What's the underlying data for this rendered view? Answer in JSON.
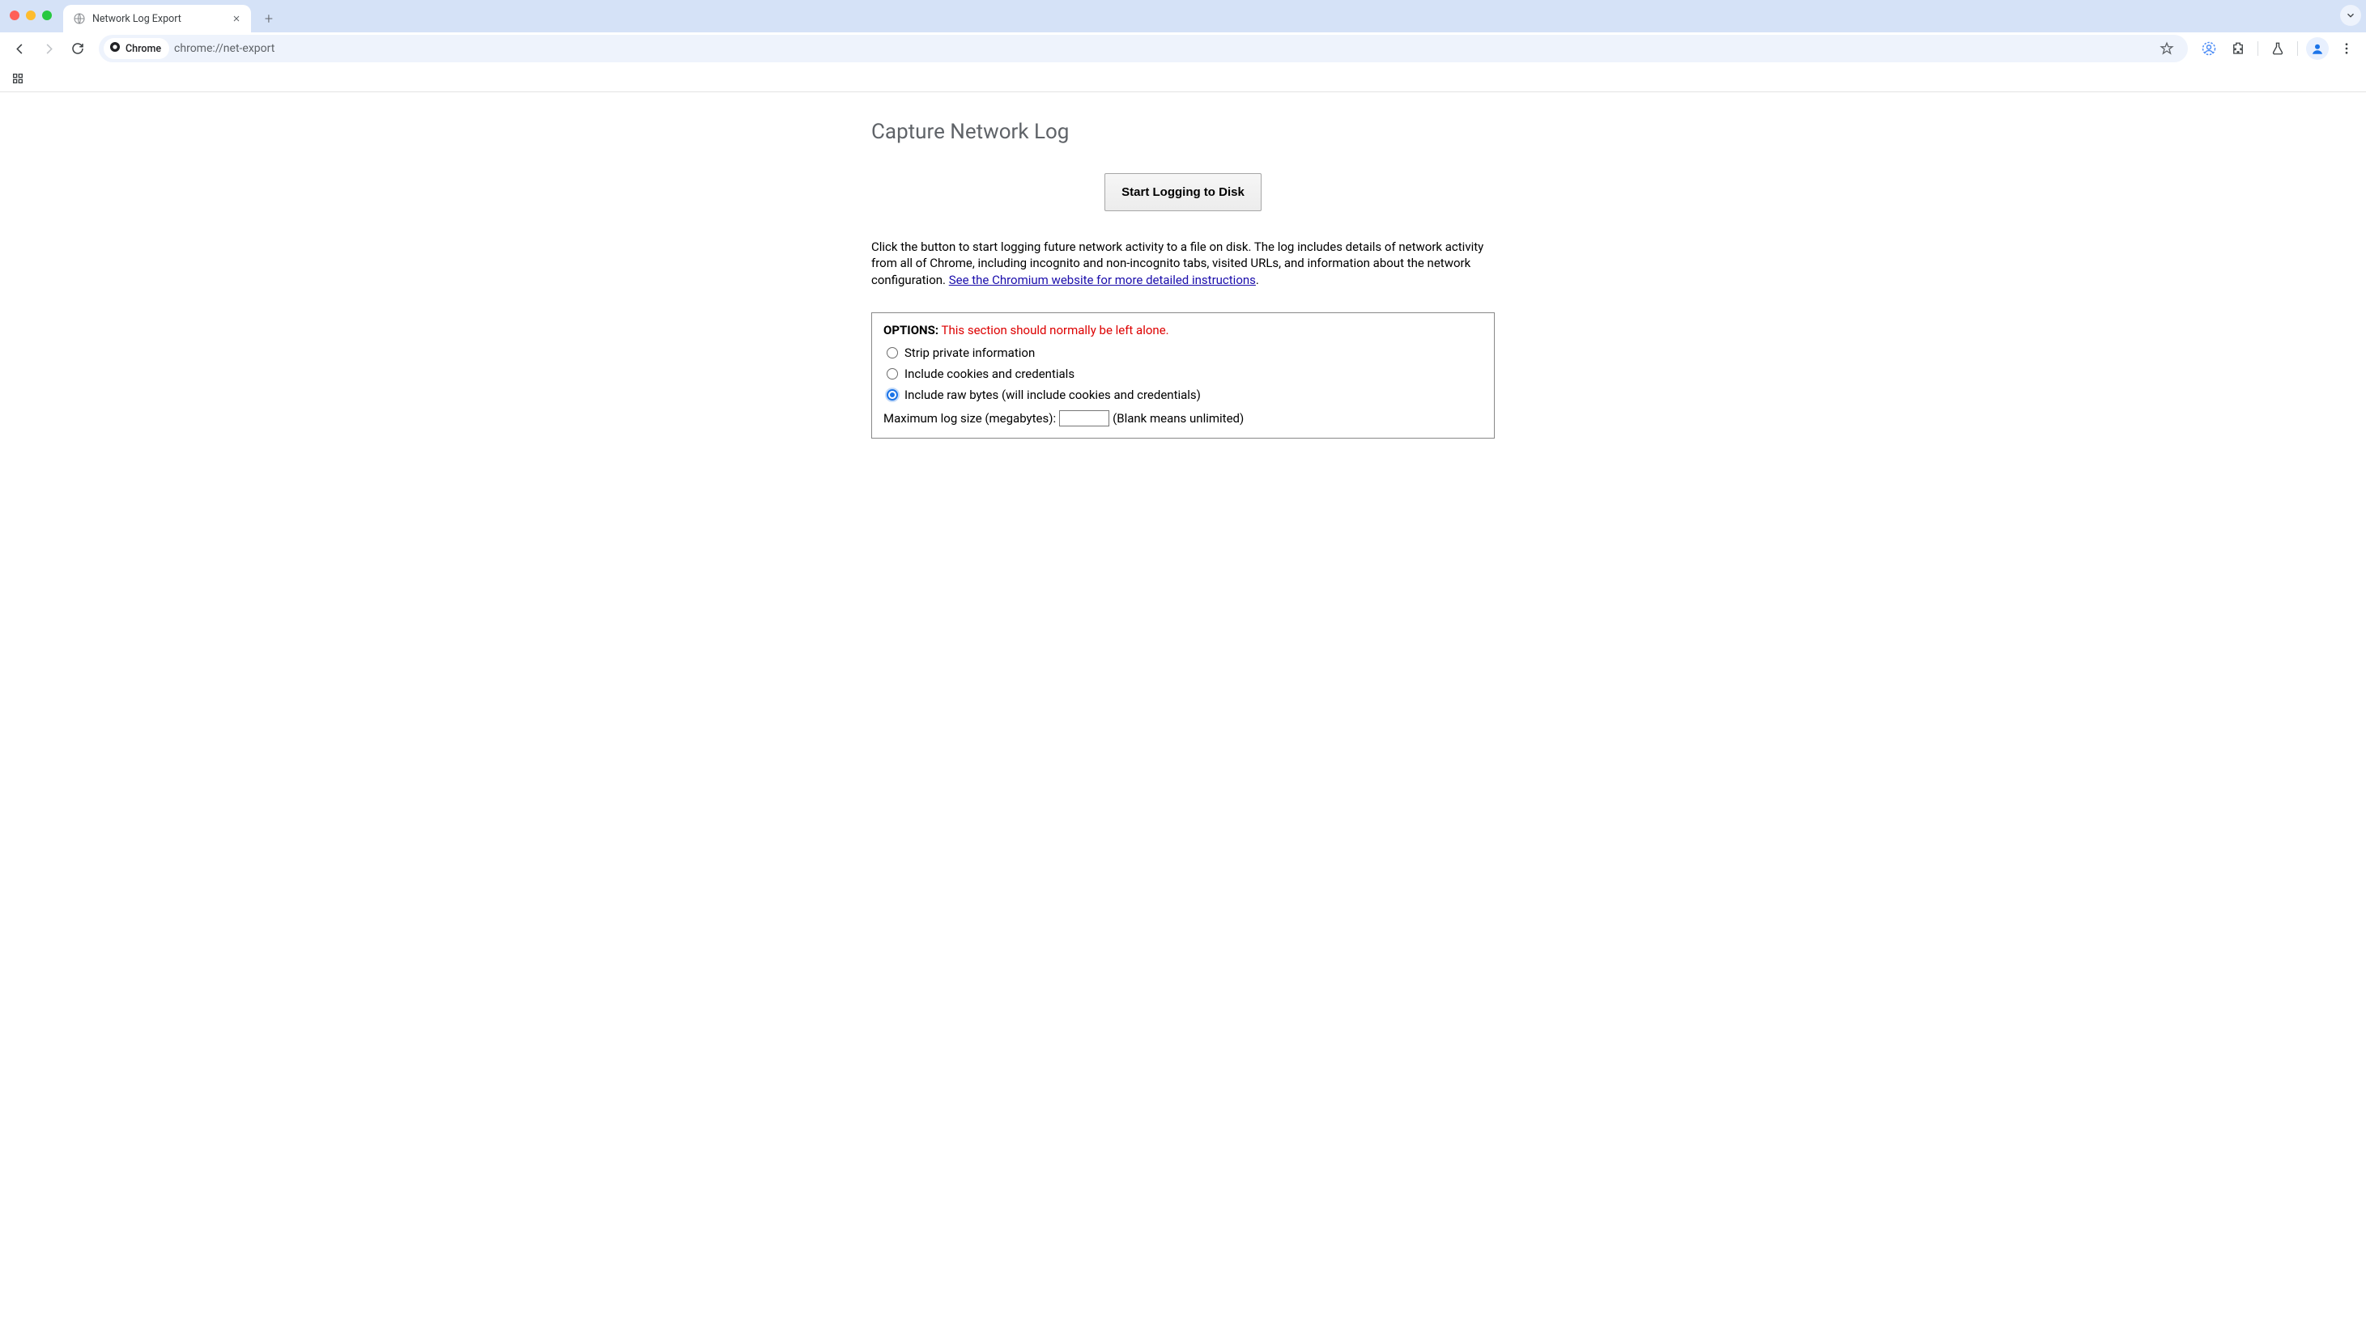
{
  "window": {
    "tab_title": "Network Log Export"
  },
  "omnibox": {
    "chip_label": "Chrome",
    "url": "chrome://net-export"
  },
  "page": {
    "title": "Capture Network Log",
    "start_button": "Start Logging to Disk",
    "description_pre": "Click the button to start logging future network activity to a file on disk. The log includes details of network activity from all of Chrome, including incognito and non-incognito tabs, visited URLs, and information about the network configuration. ",
    "description_link": "See the Chromium website for more detailed instructions",
    "description_post": ".",
    "options": {
      "header_label": "OPTIONS:",
      "header_warning": "This section should normally be left alone.",
      "radios": [
        {
          "label": "Strip private information",
          "selected": false
        },
        {
          "label": "Include cookies and credentials",
          "selected": false
        },
        {
          "label": "Include raw bytes (will include cookies and credentials)",
          "selected": true
        }
      ],
      "max_size_label": "Maximum log size (megabytes):",
      "max_size_value": "",
      "max_size_hint": "(Blank means unlimited)"
    }
  }
}
